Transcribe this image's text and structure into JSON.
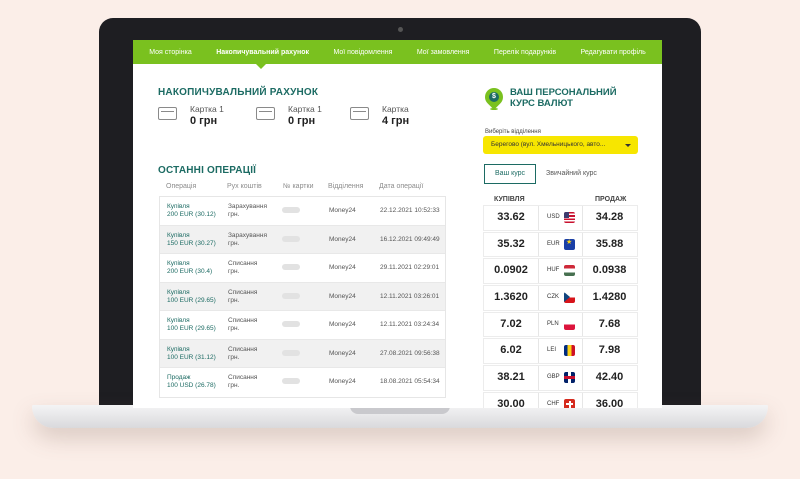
{
  "nav": {
    "items": [
      "Моя сторінка",
      "Накопичувальний рахунок",
      "Мої повідомлення",
      "Мої замовлення",
      "Перелік подарунків",
      "Редагувати профіль"
    ],
    "active_index": 1
  },
  "accumulation": {
    "title": "НАКОПИЧУВАЛЬНИЙ РАХУНОК",
    "cards": [
      {
        "label": "Картка 1",
        "balance": "0 грн"
      },
      {
        "label": "Картка 1",
        "balance": "0 грн"
      },
      {
        "label": "Картка",
        "balance": "4 грн"
      }
    ]
  },
  "operations": {
    "title": "ОСТАННІ ОПЕРАЦІЇ",
    "columns": [
      "Операція",
      "Рух коштів",
      "№ картки",
      "Відділення",
      "Дата операції"
    ],
    "rows": [
      {
        "type_line1": "Купівля",
        "type_line2": "200 EUR (30.12)",
        "flow_line1": "Зарахування",
        "flow_line2": "грн.",
        "branch": "Money24",
        "date": "22.12.2021 10:52:33"
      },
      {
        "type_line1": "Купівля",
        "type_line2": "150 EUR (30.27)",
        "flow_line1": "Зарахування",
        "flow_line2": "грн.",
        "branch": "Money24",
        "date": "16.12.2021 09:49:49"
      },
      {
        "type_line1": "Купівля",
        "type_line2": "200 EUR (30.4)",
        "flow_line1": "Списання",
        "flow_line2": "грн.",
        "branch": "Money24",
        "date": "29.11.2021 02:29:01"
      },
      {
        "type_line1": "Купівля",
        "type_line2": "100 EUR (29.65)",
        "flow_line1": "Списання",
        "flow_line2": "грн.",
        "branch": "Money24",
        "date": "12.11.2021 03:26:01"
      },
      {
        "type_line1": "Купівля",
        "type_line2": "100 EUR (29.65)",
        "flow_line1": "Списання",
        "flow_line2": "грн.",
        "branch": "Money24",
        "date": "12.11.2021 03:24:34"
      },
      {
        "type_line1": "Купівля",
        "type_line2": "100 EUR (31.12)",
        "flow_line1": "Списання",
        "flow_line2": "грн.",
        "branch": "Money24",
        "date": "27.08.2021 09:56:38"
      },
      {
        "type_line1": "Продаж",
        "type_line2": "100 USD (26.78)",
        "flow_line1": "Списання",
        "flow_line2": "грн.",
        "branch": "Money24",
        "date": "18.08.2021 05:54:34"
      }
    ]
  },
  "rates_panel": {
    "pin_symbol": "$",
    "title": "ВАШ ПЕРСОНАЛЬНИЙ КУРС ВАЛЮТ",
    "branch_label": "Виберіть відділення",
    "branch_value": "Берегово (вул. Хмельницького, авто...",
    "tab_personal": "Ваш курс",
    "tab_regular": "Звичайний курс",
    "buy_header": "КУПІВЛЯ",
    "sell_header": "ПРОДАЖ",
    "rows": [
      {
        "currency": "USD",
        "flag": "usd-flag-icon",
        "buy": "33.62",
        "sell": "34.28"
      },
      {
        "currency": "EUR",
        "flag": "eu-flag-icon",
        "buy": "35.32",
        "sell": "35.88"
      },
      {
        "currency": "HUF",
        "flag": "hungary-flag-icon",
        "buy": "0.0902",
        "sell": "0.0938"
      },
      {
        "currency": "CZK",
        "flag": "czech-flag-icon",
        "buy": "1.3620",
        "sell": "1.4280"
      },
      {
        "currency": "PLN",
        "flag": "poland-flag-icon",
        "buy": "7.02",
        "sell": "7.68"
      },
      {
        "currency": "LEI",
        "flag": "romania-flag-icon",
        "buy": "6.02",
        "sell": "7.98"
      },
      {
        "currency": "GBP",
        "flag": "uk-flag-icon",
        "buy": "38.21",
        "sell": "42.40"
      },
      {
        "currency": "CHF",
        "flag": "swiss-flag-icon",
        "buy": "30.00",
        "sell": "36.00"
      }
    ]
  },
  "colors": {
    "accent_green": "#7ac11f",
    "heading_teal": "#1c6b63",
    "select_yellow": "#f7e600",
    "background": "#fbeee8"
  }
}
